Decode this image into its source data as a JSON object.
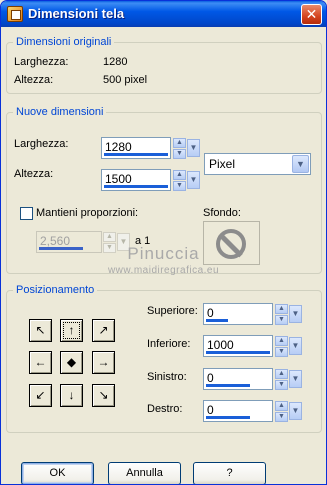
{
  "window": {
    "title": "Dimensioni tela",
    "close_symbol": "✕"
  },
  "original": {
    "legend": "Dimensioni originali",
    "width_label": "Larghezza:",
    "width_value": "1280",
    "height_label": "Altezza:",
    "height_value": "500 pixel"
  },
  "new_dims": {
    "legend": "Nuove dimensioni",
    "width_label": "Larghezza:",
    "width_value": "1280",
    "height_label": "Altezza:",
    "height_value": "1500",
    "unit_selected": "Pixel",
    "keep_proportions_label": "Mantieni proporzioni:",
    "keep_proportions_checked": false,
    "ratio_value": "2,560",
    "ratio_suffix": "a 1",
    "background_label": "Sfondo:"
  },
  "watermark": {
    "line1": "Pinuccia",
    "line2": "www.maidiregrafica.eu"
  },
  "placement": {
    "legend": "Posizionamento",
    "anchors": [
      "↖",
      "↑",
      "↗",
      "←",
      "◆",
      "→",
      "↙",
      "↓",
      "↘"
    ],
    "selected_anchor": "top-center",
    "top_label": "Superiore:",
    "top_value": "0",
    "bottom_label": "Inferiore:",
    "bottom_value": "1000",
    "left_label": "Sinistro:",
    "left_value": "0",
    "right_label": "Destro:",
    "right_value": "0"
  },
  "buttons": {
    "ok": "OK",
    "cancel": "Annulla",
    "help": "?"
  },
  "colors": {
    "title_bar": "#0058e6",
    "legend_text": "#0046d5",
    "face": "#ece9d8",
    "value_bar": "#1a5fd8"
  }
}
